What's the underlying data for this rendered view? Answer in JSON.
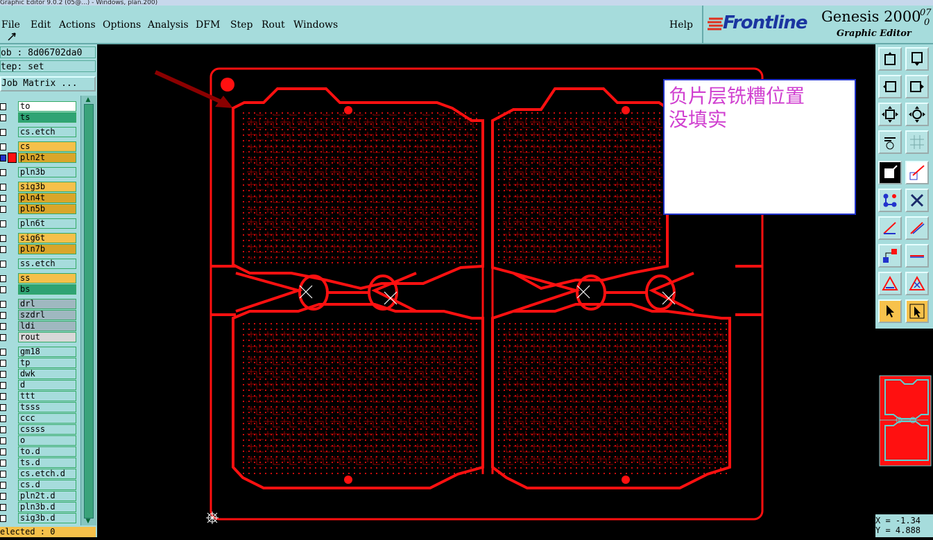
{
  "window": {
    "title": "Graphic Editor 9.0.2 (05@...) - Windows, plan.200)"
  },
  "menu": {
    "items": [
      "File",
      "Edit",
      "Actions",
      "Options",
      "Analysis",
      "DFM",
      "Step",
      "Rout",
      "Windows"
    ],
    "help": "Help"
  },
  "branding": {
    "logo": "Frontline",
    "product": "Genesis 2000",
    "subtitle": "Graphic Editor",
    "version_top": "07",
    "version_bottom": "0"
  },
  "job": {
    "job_label": "ob : 8d06702da0",
    "step_label": "tep: set",
    "matrix_button": "Job Matrix ..."
  },
  "layers": [
    {
      "name": "to",
      "color": "#ffffff"
    },
    {
      "name": "ts",
      "color": "#2fa374"
    },
    {
      "name": "cs.etch",
      "color": "#a6dcdc"
    },
    {
      "name": "cs",
      "color": "#f5c04a"
    },
    {
      "name": "pln2t",
      "color": "#d9a62a",
      "active": true
    },
    {
      "name": "pln3b",
      "color": "#a6dcdc"
    },
    {
      "name": "sig3b",
      "color": "#f5c04a"
    },
    {
      "name": "pln4t",
      "color": "#d9a62a"
    },
    {
      "name": "pln5b",
      "color": "#d9a62a"
    },
    {
      "name": "pln6t",
      "color": "#a6dcdc"
    },
    {
      "name": "sig6t",
      "color": "#f5c04a"
    },
    {
      "name": "pln7b",
      "color": "#d9a62a"
    },
    {
      "name": "ss.etch",
      "color": "#a6dcdc"
    },
    {
      "name": "ss",
      "color": "#f5c04a"
    },
    {
      "name": "bs",
      "color": "#2fa374"
    },
    {
      "name": "drl",
      "color": "#9fb8c0"
    },
    {
      "name": "szdrl",
      "color": "#9fb8c0"
    },
    {
      "name": "ldi",
      "color": "#9fb8c0"
    },
    {
      "name": "rout",
      "color": "#d8d8d8"
    },
    {
      "name": "gm18",
      "color": "#a6dcdc"
    },
    {
      "name": "tp",
      "color": "#a6dcdc"
    },
    {
      "name": "dwk",
      "color": "#a6dcdc"
    },
    {
      "name": "d",
      "color": "#a6dcdc"
    },
    {
      "name": "ttt",
      "color": "#a6dcdc"
    },
    {
      "name": "tsss",
      "color": "#a6dcdc"
    },
    {
      "name": "ccc",
      "color": "#a6dcdc"
    },
    {
      "name": "cssss",
      "color": "#a6dcdc"
    },
    {
      "name": "o",
      "color": "#a6dcdc"
    },
    {
      "name": "to.d",
      "color": "#a6dcdc"
    },
    {
      "name": "ts.d",
      "color": "#a6dcdc"
    },
    {
      "name": "cs.etch.d",
      "color": "#a6dcdc"
    },
    {
      "name": "cs.d",
      "color": "#a6dcdc"
    },
    {
      "name": "pln2t.d",
      "color": "#a6dcdc"
    },
    {
      "name": "pln3b.d",
      "color": "#a6dcdc"
    },
    {
      "name": "sig3b.d",
      "color": "#a6dcdc"
    }
  ],
  "status": {
    "selected": "elected : 0"
  },
  "annotation": {
    "line1": "负片层铣糟位置",
    "line2": "没填实"
  },
  "coords": {
    "x": "X = -1.34",
    "y": "Y = 4.888"
  },
  "colors": {
    "board": "#ff1010",
    "panel_bg": "#a6dcdc",
    "annotation_text": "#d040d0"
  }
}
